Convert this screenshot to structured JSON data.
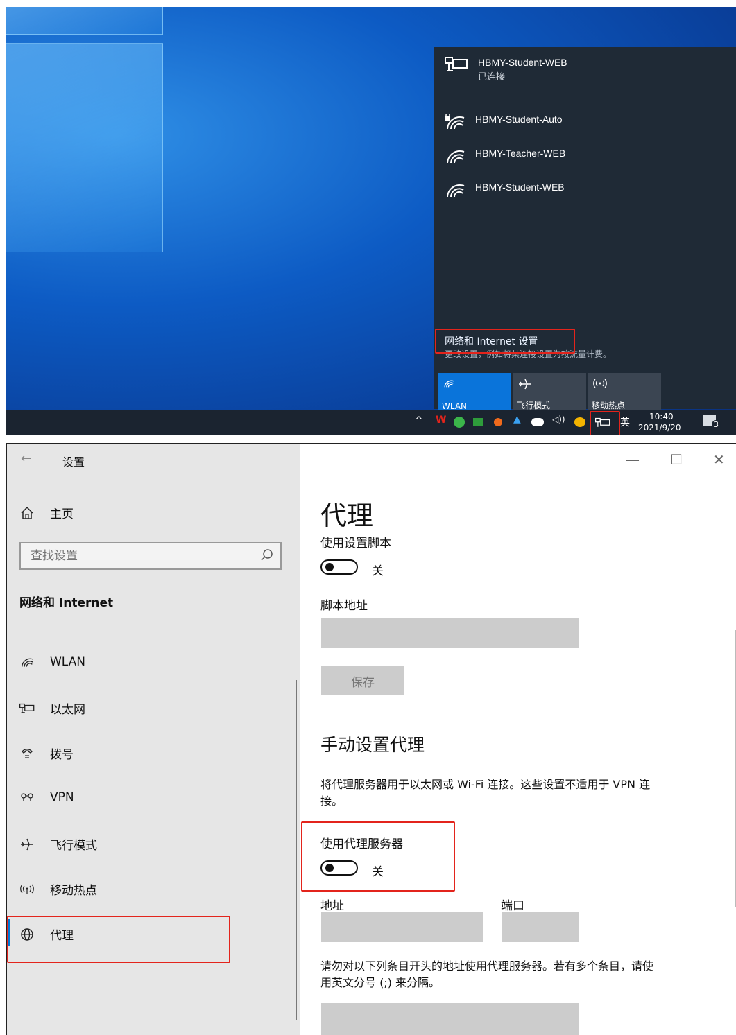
{
  "desktop": {
    "network_panel": {
      "networks": [
        {
          "name": "HBMY-Student-WEB",
          "status": "已连接",
          "icon": "ethernet-icon"
        },
        {
          "name": "HBMY-Student-Auto",
          "icon": "wifi-secure-icon"
        },
        {
          "name": "HBMY-Teacher-WEB",
          "icon": "wifi-icon"
        },
        {
          "name": "HBMY-Student-WEB",
          "icon": "wifi-icon"
        }
      ],
      "settings_link": "网络和 Internet 设置",
      "settings_sub": "更改设置，例如将某连接设置为按流量计费。",
      "quick_tiles": [
        {
          "label": "WLAN",
          "icon": "wifi-icon",
          "active": true
        },
        {
          "label": "飞行模式",
          "icon": "airplane-icon",
          "active": false
        },
        {
          "label": "移动热点",
          "icon": "hotspot-icon",
          "active": false
        }
      ]
    },
    "taskbar": {
      "ime": "英",
      "time": "10:40",
      "date": "2021/9/20",
      "notification_count": "3"
    },
    "highlight_color": "#e3241c",
    "panel_bg": "#1f2a36",
    "accent": "#0078d7"
  },
  "settings": {
    "title": "设置",
    "window_controls": {
      "minimize": "—",
      "maximize": "☐",
      "close": "✕"
    },
    "sidebar": {
      "home": "主页",
      "search_placeholder": "查找设置",
      "section": "网络和 Internet",
      "items": [
        {
          "label": "WLAN",
          "icon": "wifi-icon"
        },
        {
          "label": "以太网",
          "icon": "ethernet-icon"
        },
        {
          "label": "拨号",
          "icon": "dialup-icon"
        },
        {
          "label": "VPN",
          "icon": "vpn-icon"
        },
        {
          "label": "飞行模式",
          "icon": "airplane-icon"
        },
        {
          "label": "移动热点",
          "icon": "hotspot-icon"
        },
        {
          "label": "代理",
          "icon": "globe-icon"
        }
      ]
    },
    "main": {
      "page_title": "代理",
      "script_label": "使用设置脚本",
      "script_toggle_state": "关",
      "script_address_label": "脚本地址",
      "save_label": "保存",
      "manual_heading": "手动设置代理",
      "manual_desc_line1": "将代理服务器用于以太网或 Wi-Fi 连接。这些设置不适用于 VPN 连",
      "manual_desc_line2": "接。",
      "use_proxy_label": "使用代理服务器",
      "use_proxy_state": "关",
      "address_label": "地址",
      "port_label": "端口",
      "exceptions_line1": "请勿对以下列条目开头的地址使用代理服务器。若有多个条目，请使",
      "exceptions_line2": "用英文分号 (;) 来分隔。"
    }
  }
}
